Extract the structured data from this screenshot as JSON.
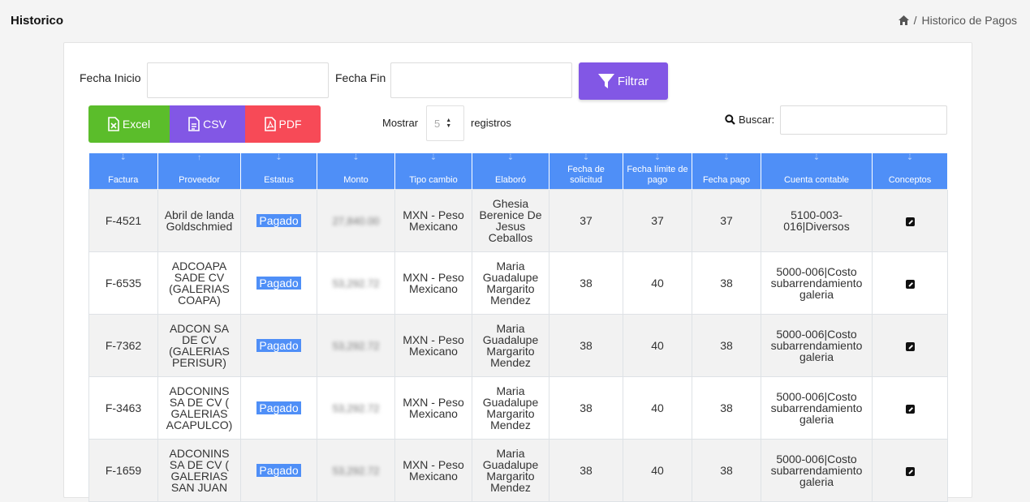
{
  "header": {
    "title": "Historico",
    "breadcrumb_current": "Historico de Pagos",
    "breadcrumb_sep": "/"
  },
  "filters": {
    "fecha_inicio_label": "Fecha Inicio",
    "fecha_fin_label": "Fecha Fin",
    "filtrar_label": "Filtrar"
  },
  "export": {
    "excel_label": "Excel",
    "csv_label": "CSV",
    "pdf_label": "PDF"
  },
  "length": {
    "mostrar_label": "Mostrar",
    "value": "5",
    "registros_label": "registros"
  },
  "search": {
    "label": "Buscar:",
    "value": ""
  },
  "colors": {
    "header_blue": "#4f8ff7",
    "purple": "#8257e5",
    "green": "#5bbd2b",
    "red": "#f74a57"
  },
  "table": {
    "columns": [
      "Factura",
      "Proveedor",
      "Estatus",
      "Monto",
      "Tipo cambio",
      "Elaboró",
      "Fecha de solicitud",
      "Fecha límite de pago",
      "Fecha pago",
      "Cuenta contable",
      "Conceptos"
    ],
    "rows": [
      {
        "factura": "F-4521",
        "proveedor": "Abril de landa Goldschmied",
        "estatus": "Pagado",
        "monto": "27,840.00",
        "tipo_cambio": "MXN - Peso Mexicano",
        "elaboro": "Ghesia Berenice De Jesus Ceballos",
        "fecha_solicitud": "37",
        "fecha_limite": "37",
        "fecha_pago": "37",
        "cuenta": "5100-003-016|Diversos"
      },
      {
        "factura": "F-6535",
        "proveedor": "ADCOAPA SADE CV (GALERIAS COAPA)",
        "estatus": "Pagado",
        "monto": "53,292.72",
        "tipo_cambio": "MXN - Peso Mexicano",
        "elaboro": "Maria Guadalupe Margarito Mendez",
        "fecha_solicitud": "38",
        "fecha_limite": "40",
        "fecha_pago": "38",
        "cuenta": "5000-006|Costo subarrendamiento galeria"
      },
      {
        "factura": "F-7362",
        "proveedor": "ADCON SA DE CV (GALERIAS PERISUR)",
        "estatus": "Pagado",
        "monto": "53,292.72",
        "tipo_cambio": "MXN - Peso Mexicano",
        "elaboro": "Maria Guadalupe Margarito Mendez",
        "fecha_solicitud": "38",
        "fecha_limite": "40",
        "fecha_pago": "38",
        "cuenta": "5000-006|Costo subarrendamiento galeria"
      },
      {
        "factura": "F-3463",
        "proveedor": "ADCONINS SA DE CV ( GALERIAS ACAPULCO)",
        "estatus": "Pagado",
        "monto": "53,292.72",
        "tipo_cambio": "MXN - Peso Mexicano",
        "elaboro": "Maria Guadalupe Margarito Mendez",
        "fecha_solicitud": "38",
        "fecha_limite": "40",
        "fecha_pago": "38",
        "cuenta": "5000-006|Costo subarrendamiento galeria"
      },
      {
        "factura": "F-1659",
        "proveedor": "ADCONINS SA DE CV ( GALERIAS SAN JUAN",
        "estatus": "Pagado",
        "monto": "53,292.72",
        "tipo_cambio": "MXN - Peso Mexicano",
        "elaboro": "Maria Guadalupe Margarito Mendez",
        "fecha_solicitud": "38",
        "fecha_limite": "40",
        "fecha_pago": "38",
        "cuenta": "5000-006|Costo subarrendamiento galeria"
      }
    ]
  }
}
